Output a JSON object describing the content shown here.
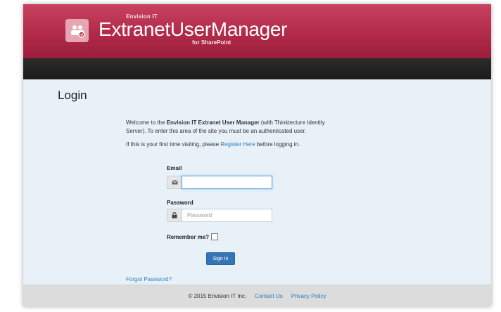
{
  "header": {
    "brand_top": "Envision IT",
    "brand_main": "ExtranetUserManager",
    "brand_sub": "for SharePoint",
    "logo_icon": "users-icon"
  },
  "page": {
    "title": "Login",
    "welcome_prefix": "Welcome to the ",
    "welcome_bold": "Envision IT Extranet User Manager",
    "welcome_suffix": " (with Thinktecture Identity Server). To enter this area of the site you must be an authenticated user.",
    "first_time_prefix": "If this is your first time visiting, please ",
    "register_link": "Register Here",
    "first_time_suffix": " before logging in."
  },
  "form": {
    "email_label": "Email",
    "email_value": "",
    "email_icon": "envelope-icon",
    "password_label": "Password",
    "password_placeholder": "Password",
    "password_icon": "lock-icon",
    "remember_label": "Remember me?",
    "remember_checked": false,
    "submit_label": "Sign In",
    "forgot_link": "Forgot Password?"
  },
  "footer": {
    "copyright": "© 2015 Envision IT Inc.",
    "contact_link": "Contact Us",
    "privacy_link": "Privacy Policy"
  },
  "colors": {
    "banner": "#b22a4a",
    "navbar": "#222222",
    "content_bg": "#e8f1f8",
    "link": "#2b7ec1",
    "button": "#3476b5"
  }
}
